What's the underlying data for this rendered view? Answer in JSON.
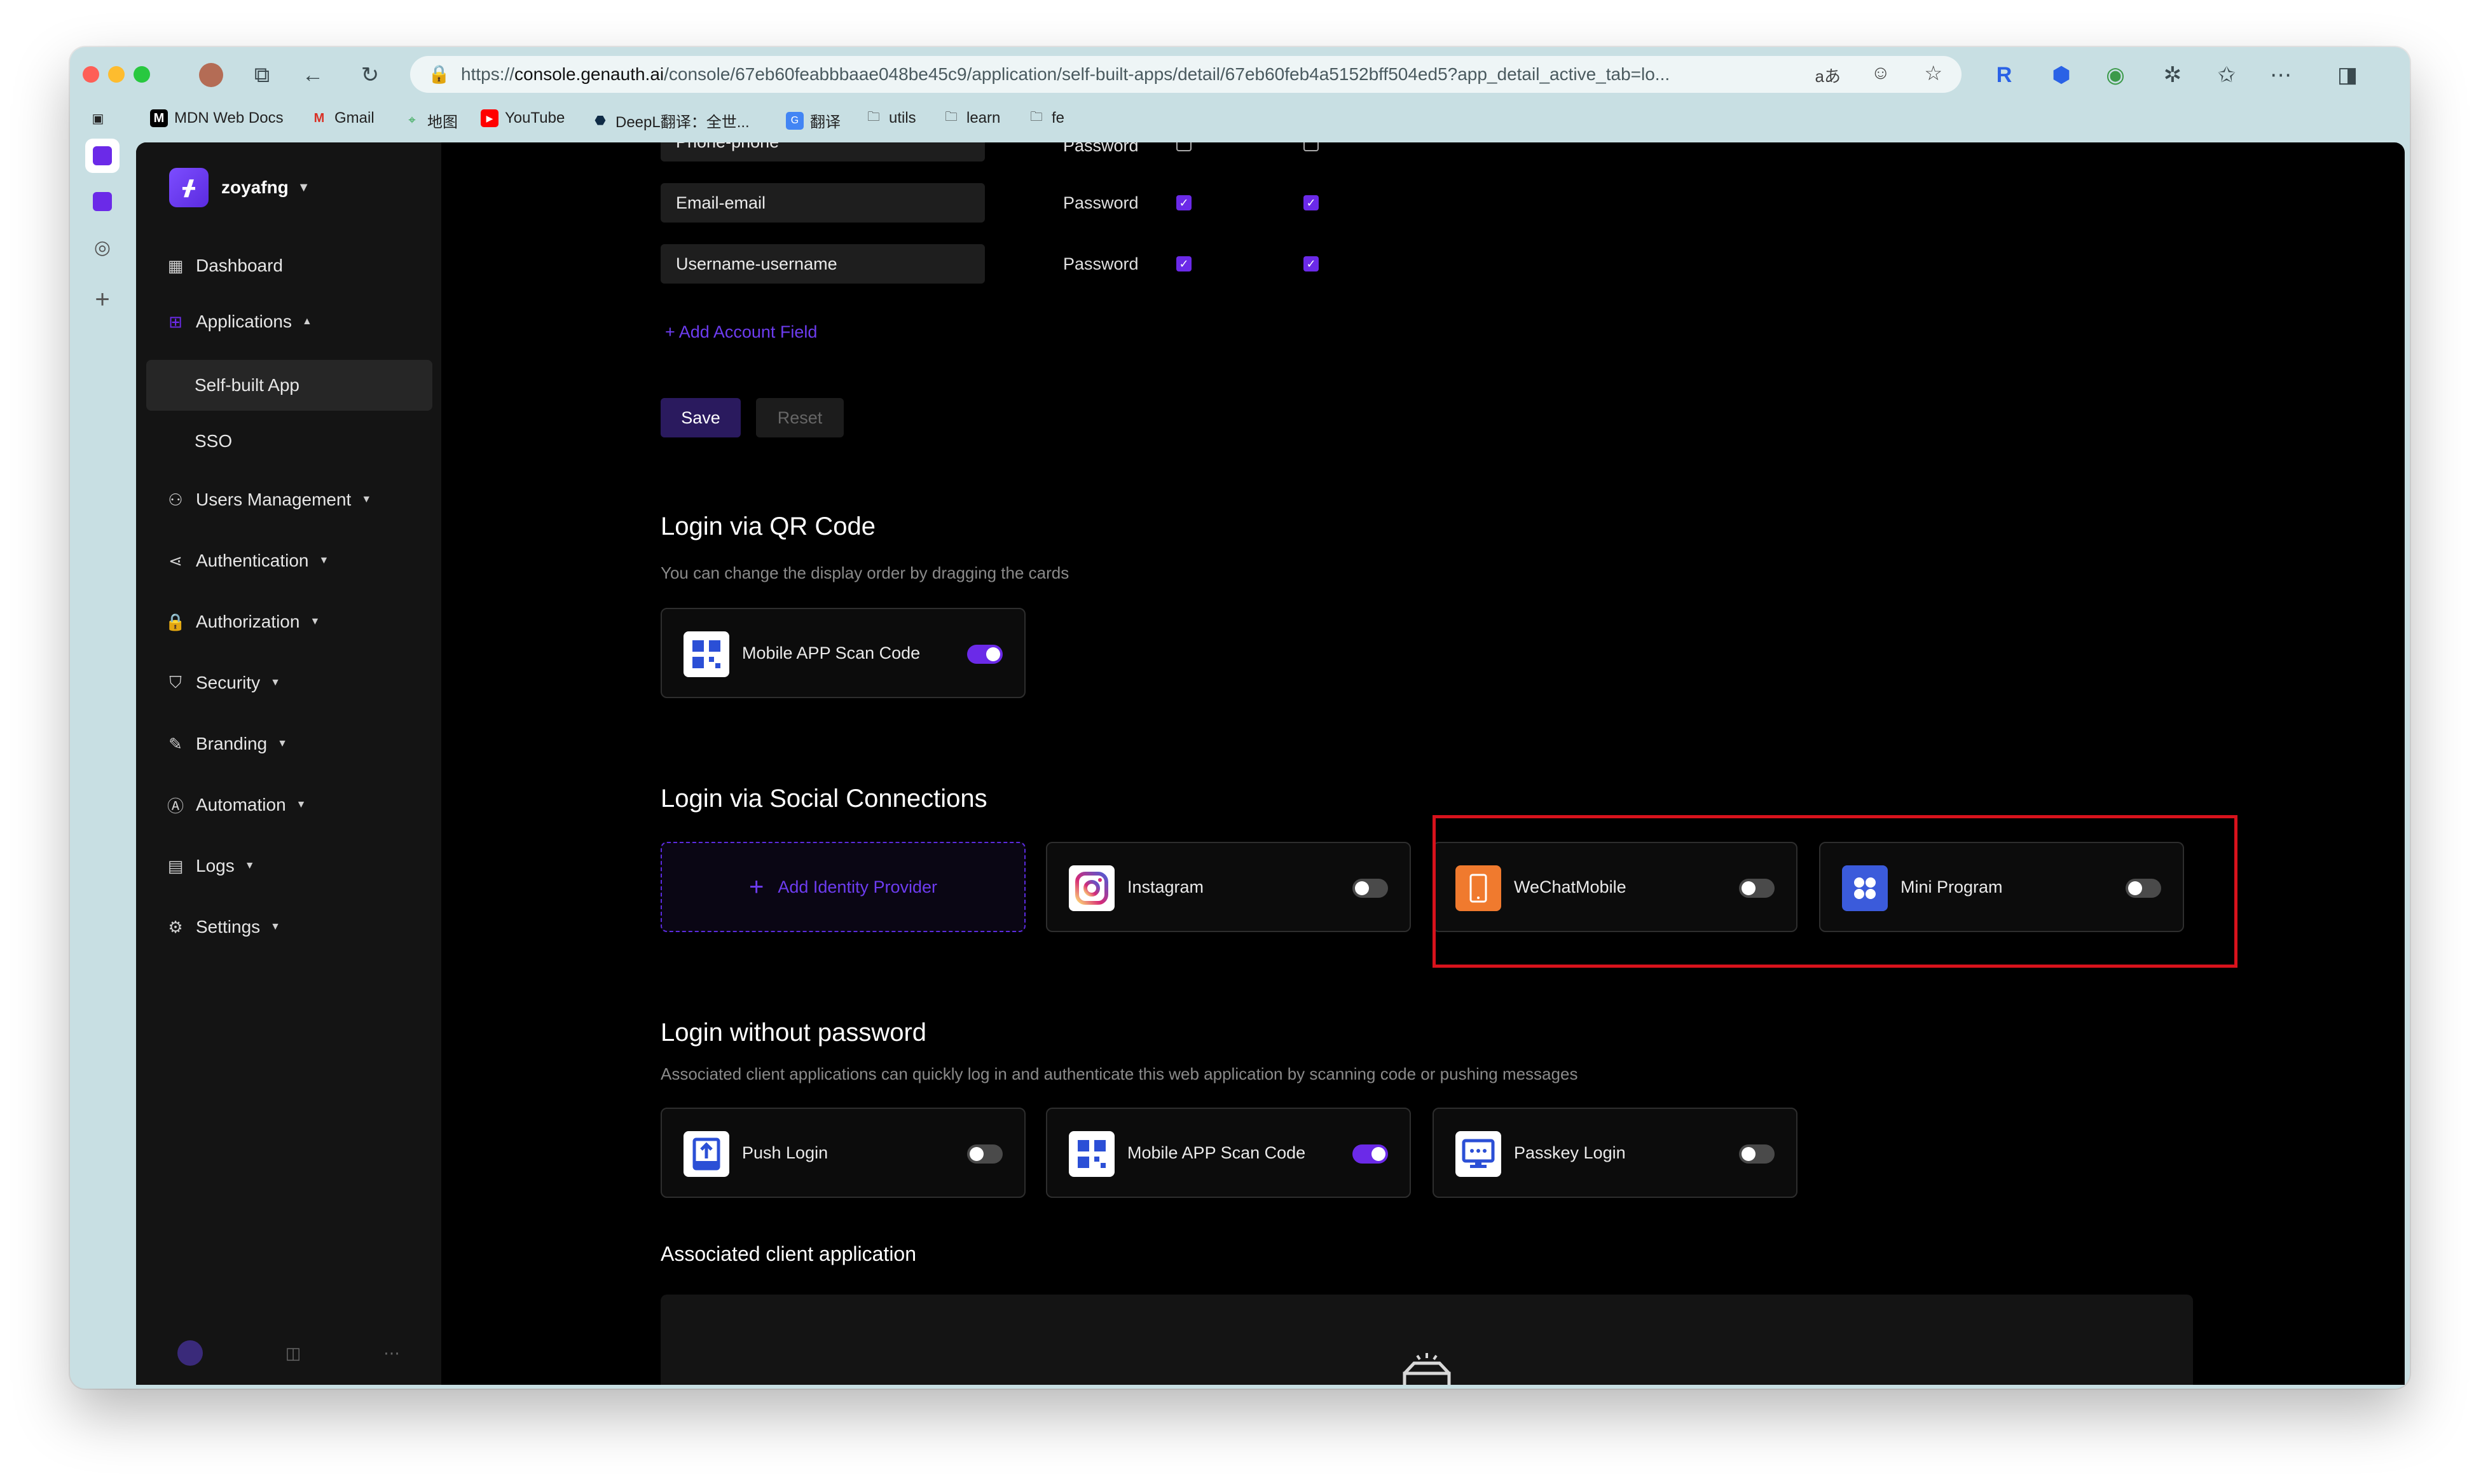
{
  "browser": {
    "url_prefix": "https://",
    "url_host": "console.genauth.ai",
    "url_path": "/console/67eb60feabbbaae048be45c9/application/self-built-apps/detail/67eb60feb4a5152bff504ed5?app_detail_active_tab=lo...",
    "translate_label": "aあ"
  },
  "bookmarks": [
    {
      "label": "MDN Web Docs",
      "icon": "mdn-icon"
    },
    {
      "label": "Gmail",
      "icon": "gmail-icon"
    },
    {
      "label": "地图",
      "icon": "maps-icon"
    },
    {
      "label": "YouTube",
      "icon": "youtube-icon"
    },
    {
      "label": "DeepL翻译：全世...",
      "icon": "deepl-icon"
    },
    {
      "label": "翻译",
      "icon": "translate-icon"
    },
    {
      "label": "utils",
      "icon": "folder-icon"
    },
    {
      "label": "learn",
      "icon": "folder-icon"
    },
    {
      "label": "fe",
      "icon": "folder-icon"
    }
  ],
  "sidebar": {
    "org_name": "zoyafng",
    "items": [
      {
        "label": "Dashboard",
        "icon": "dashboard-icon"
      },
      {
        "label": "Applications",
        "icon": "apps-icon"
      },
      {
        "label": "Self-built App"
      },
      {
        "label": "SSO"
      },
      {
        "label": "Users Management",
        "icon": "user-icon"
      },
      {
        "label": "Authentication",
        "icon": "share-icon"
      },
      {
        "label": "Authorization",
        "icon": "lock-icon"
      },
      {
        "label": "Security",
        "icon": "shield-icon"
      },
      {
        "label": "Branding",
        "icon": "brush-icon"
      },
      {
        "label": "Automation",
        "icon": "automation-icon"
      },
      {
        "label": "Logs",
        "icon": "logs-icon"
      },
      {
        "label": "Settings",
        "icon": "gear-icon"
      }
    ]
  },
  "account_fields": {
    "rows": [
      {
        "name": "Phone-phone",
        "type": "Password",
        "col1": false,
        "col2": false
      },
      {
        "name": "Email-email",
        "type": "Password",
        "col1": true,
        "col2": true
      },
      {
        "name": "Username-username",
        "type": "Password",
        "col1": true,
        "col2": true
      }
    ],
    "add_label": "+ Add Account Field",
    "save_label": "Save",
    "reset_label": "Reset"
  },
  "qr_section": {
    "title": "Login via QR Code",
    "description": "You can change the display order by dragging the cards",
    "cards": [
      {
        "label": "Mobile APP Scan Code",
        "enabled": true
      }
    ]
  },
  "social_section": {
    "title": "Login via Social Connections",
    "add_label": "Add Identity Provider",
    "cards": [
      {
        "label": "Instagram",
        "enabled": false
      },
      {
        "label": "WeChatMobile",
        "enabled": false
      },
      {
        "label": "Mini Program",
        "enabled": false
      }
    ]
  },
  "passwordless_section": {
    "title": "Login without password",
    "description": "Associated client applications can quickly log in and authenticate this web application by scanning code or pushing messages",
    "cards": [
      {
        "label": "Push Login",
        "enabled": false
      },
      {
        "label": "Mobile APP Scan Code",
        "enabled": true
      },
      {
        "label": "Passkey Login",
        "enabled": false
      }
    ]
  },
  "associated_section": {
    "title": "Associated client application"
  },
  "colors": {
    "accent": "#6b2ae8",
    "highlight": "#d8121c",
    "wechat": "#f07a2e",
    "mini_program": "#3b5bdb"
  }
}
